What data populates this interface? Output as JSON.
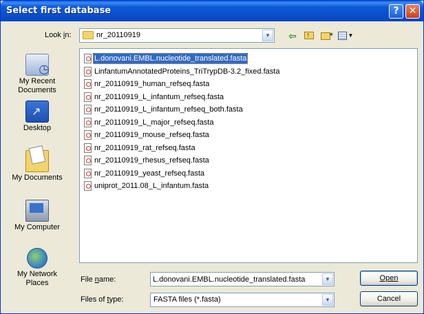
{
  "window": {
    "title": "Select first database",
    "help_glyph": "?",
    "close_glyph": "✕"
  },
  "lookin": {
    "label": "Look in:",
    "value": "nr_20110919"
  },
  "toolbar": {
    "icons": [
      "back-icon",
      "up-folder-icon",
      "new-folder-icon",
      "views-menu-icon"
    ]
  },
  "places": [
    {
      "label": "My Recent Documents",
      "icon": "recent-documents-icon"
    },
    {
      "label": "Desktop",
      "icon": "desktop-icon"
    },
    {
      "label": "My Documents",
      "icon": "my-documents-icon"
    },
    {
      "label": "My Computer",
      "icon": "my-computer-icon"
    },
    {
      "label": "My Network Places",
      "icon": "network-places-icon"
    }
  ],
  "files": [
    "L.donovani.EMBL.nucleotide_translated.fasta",
    "LinfantumAnnotatedProteins_TriTrypDB-3.2_fixed.fasta",
    "nr_20110919_human_refseq.fasta",
    "nr_20110919_L_infantum_refseq.fasta",
    "nr_20110919_L_infantum_refseq_both.fasta",
    "nr_20110919_L_major_refseq.fasta",
    "nr_20110919_mouse_refseq.fasta",
    "nr_20110919_rat_refseq.fasta",
    "nr_20110919_rhesus_refseq.fasta",
    "nr_20110919_yeast_refseq.fasta",
    "uniprot_2011.08_L_infantum.fasta"
  ],
  "selected_file": "L.donovani.EMBL.nucleotide_translated.fasta",
  "filename": {
    "label": "File name:",
    "value": "L.donovani.EMBL.nucleotide_translated.fasta"
  },
  "filetype": {
    "label": "Files of type:",
    "value": "FASTA files (*.fasta)"
  },
  "buttons": {
    "open": "Open",
    "cancel": "Cancel"
  }
}
